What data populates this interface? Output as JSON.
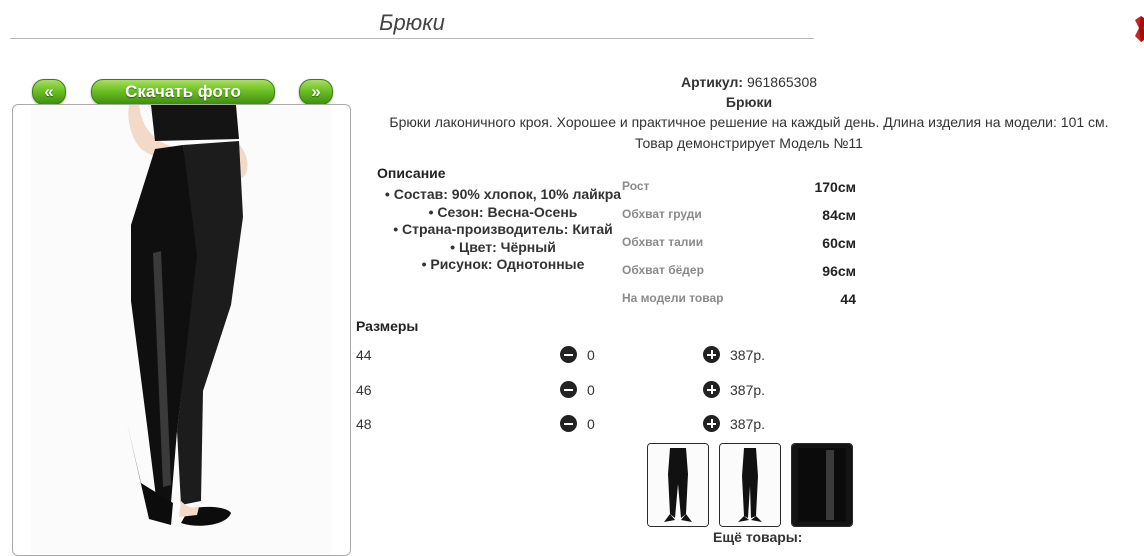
{
  "header": {
    "title": "Брюки"
  },
  "gallery": {
    "prev_label": "«",
    "download_label": "Скачать фото",
    "next_label": "»"
  },
  "product": {
    "article_label": "Артикул:",
    "article_value": "961865308",
    "name": "Брюки",
    "description": "Брюки лаконичного кроя. Хорошее и практичное решение на каждый день. Длина изделия на модели: 101 см.",
    "model_note": "Товар демонстрирует Модель №11"
  },
  "description": {
    "heading": "Описание",
    "items": [
      "Состав: 90% хлопок, 10% лайкра",
      "Сезон: Весна-Осень",
      "Страна-производитель: Китай",
      "Цвет: Чёрный",
      "Рисунок: Однотонные"
    ]
  },
  "model_params": [
    {
      "label": "Рост",
      "value": "170см"
    },
    {
      "label": "Обхват груди",
      "value": "84см"
    },
    {
      "label": "Обхват талии",
      "value": "60см"
    },
    {
      "label": "Обхват бёдер",
      "value": "96см"
    },
    {
      "label": "На модели товар",
      "value": "44"
    }
  ],
  "sizes": {
    "heading": "Размеры",
    "rows": [
      {
        "size": "44",
        "qty": "0",
        "price": "387р."
      },
      {
        "size": "46",
        "qty": "0",
        "price": "387р."
      },
      {
        "size": "48",
        "qty": "0",
        "price": "387р."
      }
    ]
  },
  "more": {
    "label": "Ещё товары:"
  },
  "icons": {
    "minus": "minus-circle-icon",
    "plus": "plus-circle-icon",
    "corner": "red-ribbon-icon"
  },
  "colors": {
    "button_green": "#6cbf25",
    "product_black": "#111111"
  }
}
